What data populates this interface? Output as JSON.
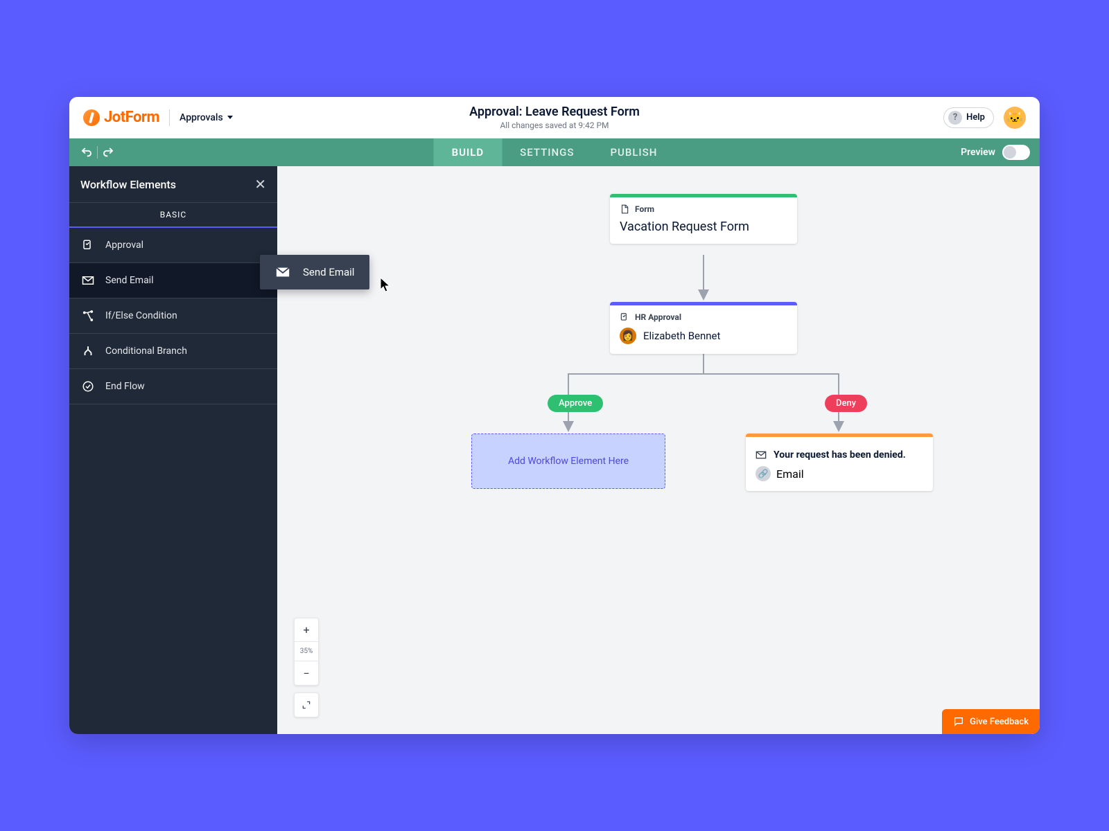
{
  "header": {
    "logo_text": "JotForm",
    "dropdown_label": "Approvals",
    "title": "Approval: Leave Request Form",
    "save_status": "All changes saved at 9:42 PM",
    "help_label": "Help"
  },
  "toolbar": {
    "tabs": [
      "BUILD",
      "SETTINGS",
      "PUBLISH"
    ],
    "active_tab": "BUILD",
    "preview_label": "Preview"
  },
  "sidebar": {
    "title": "Workflow Elements",
    "tab_label": "BASIC",
    "items": [
      {
        "label": "Approval",
        "icon": "approval-icon"
      },
      {
        "label": "Send Email",
        "icon": "mail-icon"
      },
      {
        "label": "If/Else Condition",
        "icon": "branch-icon"
      },
      {
        "label": "Conditional Branch",
        "icon": "split-icon"
      },
      {
        "label": "End Flow",
        "icon": "check-circle-icon"
      }
    ]
  },
  "drag_ghost": {
    "label": "Send Email"
  },
  "canvas": {
    "form_node": {
      "label": "Form",
      "title": "Vacation Request Form",
      "accent": "#2fbf71"
    },
    "approval_node": {
      "label": "HR Approval",
      "approver": "Elizabeth Bennet",
      "accent": "#5b5cff"
    },
    "approve_pill": "Approve",
    "deny_pill": "Deny",
    "dropzone_text": "Add Workflow Element Here",
    "deny_node": {
      "title": "Your request has been denied.",
      "chip": "Email",
      "accent": "#ff9a3c"
    },
    "zoom_level": "35%"
  },
  "feedback_label": "Give Feedback",
  "colors": {
    "approve": "#2fbf71",
    "deny": "#ef3e5b"
  }
}
